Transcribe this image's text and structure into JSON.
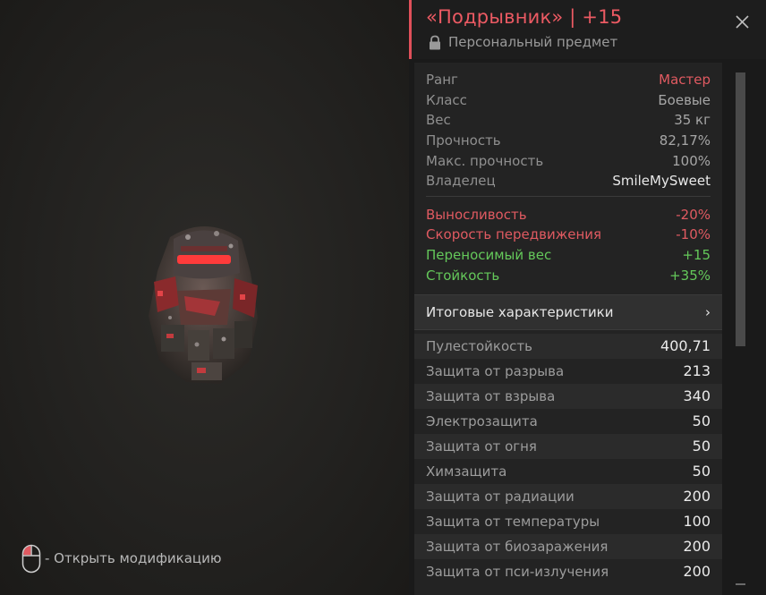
{
  "hint": {
    "text": "- Открыть модификацию"
  },
  "item": {
    "title": "«Подрывник» | +15",
    "subtitle": "Персональный предмет"
  },
  "info": [
    {
      "label": "Ранг",
      "value": "Мастер",
      "accent": "red"
    },
    {
      "label": "Класс",
      "value": "Боевые"
    },
    {
      "label": "Вес",
      "value": "35 кг"
    },
    {
      "label": "Прочность",
      "value": "82,17%"
    },
    {
      "label": "Макс. прочность",
      "value": "100%"
    },
    {
      "label": "Владелец",
      "value": "SmileMySweet",
      "accent": "white"
    }
  ],
  "modifiers": [
    {
      "label": "Выносливость",
      "value": "-20%",
      "color": "red"
    },
    {
      "label": "Скорость передвижения",
      "value": "-10%",
      "color": "red"
    },
    {
      "label": "Переносимый вес",
      "value": "+15",
      "color": "green"
    },
    {
      "label": "Стойкость",
      "value": "+35%",
      "color": "green"
    }
  ],
  "summary": {
    "label": "Итоговые характеристики",
    "chevron": "›"
  },
  "stats": [
    {
      "label": "Пулестойкость",
      "value": "400,71"
    },
    {
      "label": "Защита от разрыва",
      "value": "213"
    },
    {
      "label": "Защита от взрыва",
      "value": "340"
    },
    {
      "label": "Электрозащита",
      "value": "50"
    },
    {
      "label": "Защита от огня",
      "value": "50"
    },
    {
      "label": "Химзащита",
      "value": "50"
    },
    {
      "label": "Защита от радиации",
      "value": "200"
    },
    {
      "label": "Защита от температуры",
      "value": "100"
    },
    {
      "label": "Защита от биозаражения",
      "value": "200"
    },
    {
      "label": "Защита от пси-излучения",
      "value": "200"
    }
  ],
  "colors": {
    "accent_red": "#e05a61",
    "accent_green": "#64c85a",
    "title_red": "#ec5a63"
  }
}
